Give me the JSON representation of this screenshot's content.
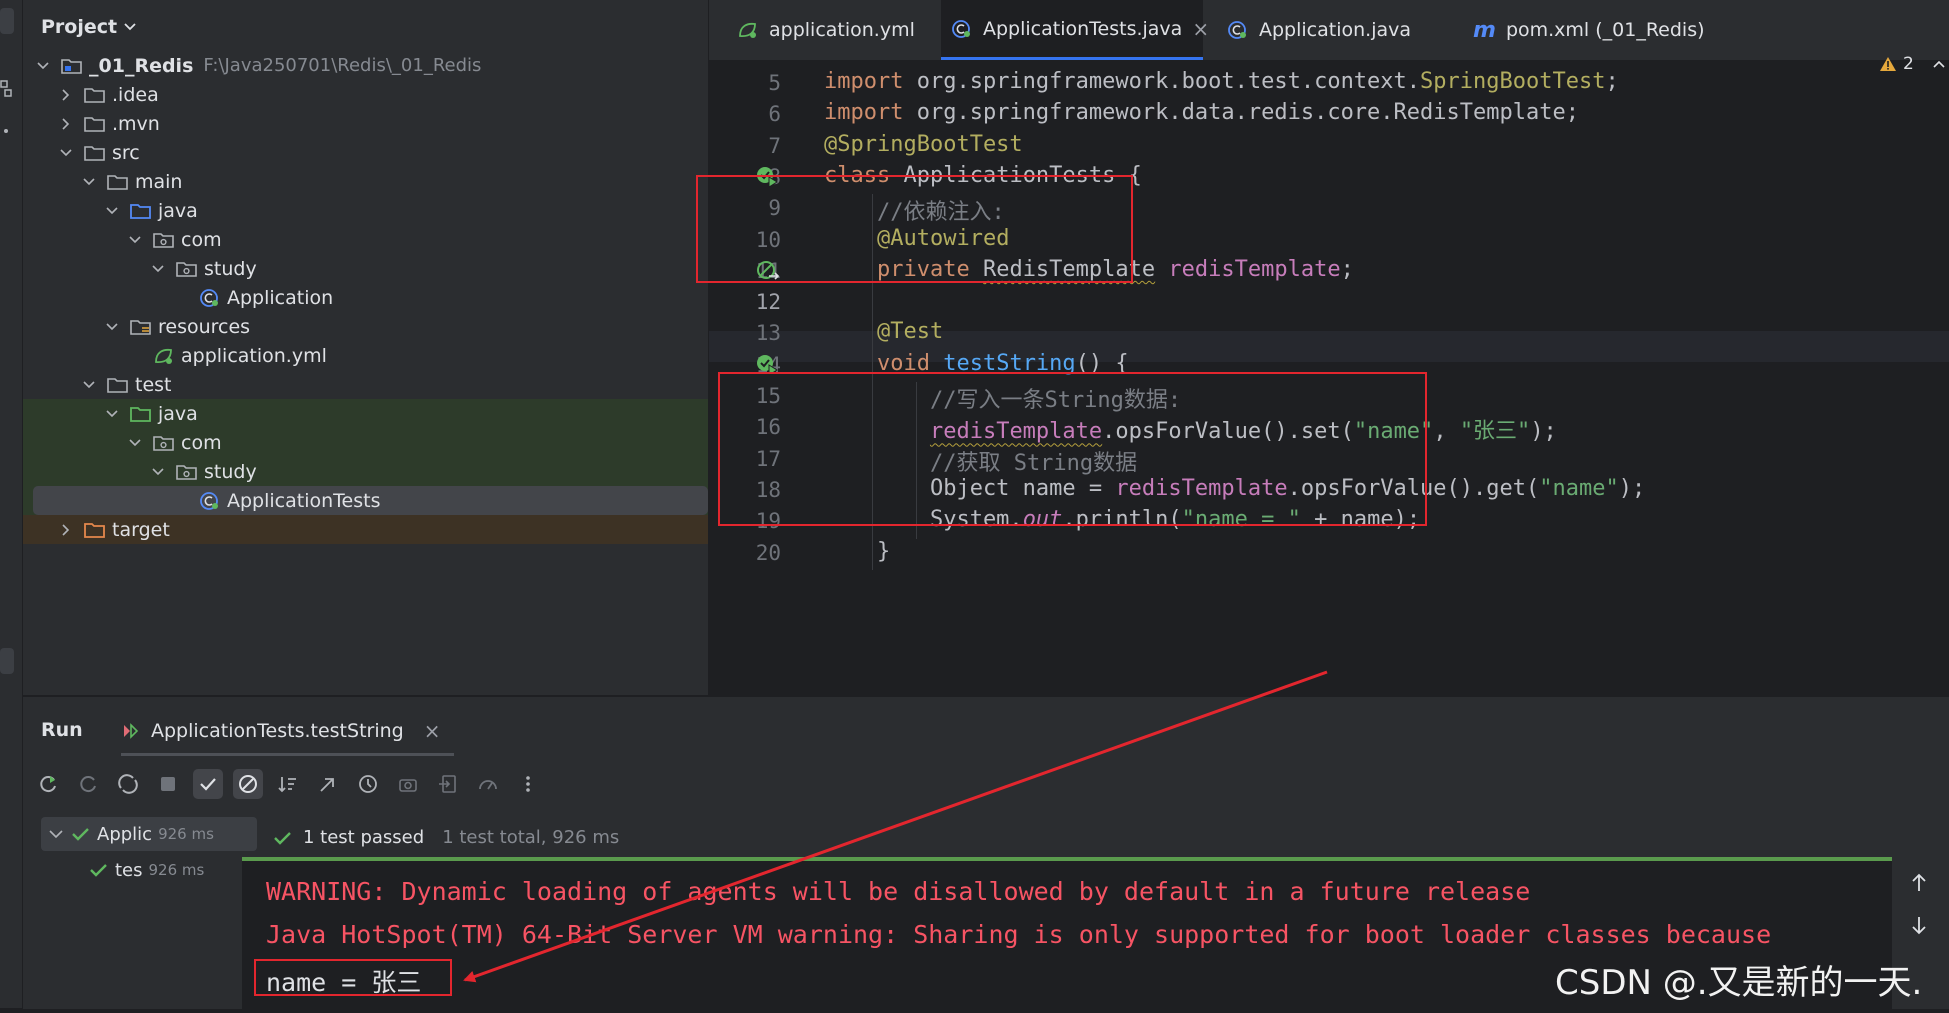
{
  "project": {
    "header": "Project",
    "tree": [
      {
        "label": "_01_Redis",
        "path": "F:\\Java250701\\Redis\\_01_Redis",
        "depth": 0,
        "expanded": true,
        "icon": "module-folder-icon",
        "bold": true
      },
      {
        "label": ".idea",
        "depth": 1,
        "expanded": false,
        "icon": "folder-icon"
      },
      {
        "label": ".mvn",
        "depth": 1,
        "expanded": false,
        "icon": "folder-icon"
      },
      {
        "label": "src",
        "depth": 1,
        "expanded": true,
        "icon": "folder-icon"
      },
      {
        "label": "main",
        "depth": 2,
        "expanded": true,
        "icon": "folder-icon"
      },
      {
        "label": "java",
        "depth": 3,
        "expanded": true,
        "icon": "source-folder-icon"
      },
      {
        "label": "com",
        "depth": 4,
        "expanded": true,
        "icon": "package-icon"
      },
      {
        "label": "study",
        "depth": 5,
        "expanded": true,
        "icon": "package-icon"
      },
      {
        "label": "Application",
        "depth": 6,
        "icon": "spring-class-icon"
      },
      {
        "label": "resources",
        "depth": 3,
        "expanded": true,
        "icon": "resources-folder-icon"
      },
      {
        "label": "application.yml",
        "depth": 4,
        "icon": "spring-yml-icon"
      },
      {
        "label": "test",
        "depth": 2,
        "expanded": true,
        "icon": "folder-icon"
      },
      {
        "label": "java",
        "depth": 3,
        "expanded": true,
        "icon": "test-folder-icon"
      },
      {
        "label": "com",
        "depth": 4,
        "expanded": true,
        "icon": "package-icon"
      },
      {
        "label": "study",
        "depth": 5,
        "expanded": true,
        "icon": "package-icon"
      },
      {
        "label": "ApplicationTests",
        "depth": 6,
        "icon": "spring-class-icon",
        "selected": true
      },
      {
        "label": "target",
        "depth": 1,
        "expanded": false,
        "icon": "excluded-folder-icon"
      }
    ]
  },
  "tabs": [
    {
      "label": "application.yml",
      "icon": "spring-yml-icon"
    },
    {
      "label": "ApplicationTests.java",
      "icon": "spring-class-icon",
      "active": true,
      "closable": "×"
    },
    {
      "label": "Application.java",
      "icon": "spring-class-icon"
    },
    {
      "label": "pom.xml (_01_Redis)",
      "icon": "maven-icon",
      "glyph": "m"
    }
  ],
  "inspection": {
    "count": "2",
    "icon": "warning-icon"
  },
  "editor": {
    "lines": [
      {
        "num": "5",
        "segments": [
          {
            "t": "import ",
            "c": "kw"
          },
          {
            "t": "org.springframework.boot.test.context.",
            "c": "cls"
          },
          {
            "t": "SpringBootTest",
            "c": "ann"
          },
          {
            "t": ";",
            "c": "cls"
          }
        ]
      },
      {
        "num": "6",
        "segments": [
          {
            "t": "import ",
            "c": "kw"
          },
          {
            "t": "org.springframework.data.redis.core.RedisTemplate;",
            "c": "cls"
          }
        ]
      },
      {
        "num": "7",
        "segments": [
          {
            "t": "@SpringBootTest",
            "c": "ann"
          }
        ]
      },
      {
        "num": "8",
        "gutter": "run-test-icon",
        "segments": [
          {
            "t": "class ",
            "c": "kw"
          },
          {
            "t": "ApplicationTests {",
            "c": "cls"
          }
        ]
      },
      {
        "num": "9",
        "segments": [
          {
            "t": "    //依赖注入:",
            "c": "cmt"
          }
        ]
      },
      {
        "num": "10",
        "segments": [
          {
            "t": "    ",
            "c": "cls"
          },
          {
            "t": "@Autowired",
            "c": "ann"
          }
        ]
      },
      {
        "num": "11",
        "gutter": "bean-navigate-icon",
        "segments": [
          {
            "t": "    ",
            "c": "cls"
          },
          {
            "t": "private ",
            "c": "kw"
          },
          {
            "t": "RedisTemplate",
            "c": "cls squiggle"
          },
          {
            "t": " ",
            "c": "cls"
          },
          {
            "t": "redisTemplate",
            "c": "fld"
          },
          {
            "t": ";",
            "c": "cls"
          }
        ]
      },
      {
        "num": "12",
        "segments": []
      },
      {
        "num": "13",
        "segments": [
          {
            "t": "    ",
            "c": "cls"
          },
          {
            "t": "@Test",
            "c": "ann"
          }
        ]
      },
      {
        "num": "14",
        "gutter": "run-test-icon",
        "segments": [
          {
            "t": "    ",
            "c": "cls"
          },
          {
            "t": "void ",
            "c": "kw"
          },
          {
            "t": "testString",
            "c": "fn"
          },
          {
            "t": "() {",
            "c": "cls"
          }
        ]
      },
      {
        "num": "15",
        "segments": [
          {
            "t": "        //写入一条String数据:",
            "c": "cmt"
          }
        ]
      },
      {
        "num": "16",
        "segments": [
          {
            "t": "        ",
            "c": "cls"
          },
          {
            "t": "redisTemplate",
            "c": "fld squiggle"
          },
          {
            "t": ".opsForValue().set(",
            "c": "cls"
          },
          {
            "t": "\"name\"",
            "c": "str"
          },
          {
            "t": ", ",
            "c": "cls"
          },
          {
            "t": "\"张三\"",
            "c": "str"
          },
          {
            "t": ");",
            "c": "cls"
          }
        ]
      },
      {
        "num": "17",
        "segments": [
          {
            "t": "        //获取 String数据",
            "c": "cmt"
          }
        ]
      },
      {
        "num": "18",
        "segments": [
          {
            "t": "        Object name = ",
            "c": "cls"
          },
          {
            "t": "redisTemplate",
            "c": "fld"
          },
          {
            "t": ".opsForValue().get(",
            "c": "cls"
          },
          {
            "t": "\"name\"",
            "c": "str"
          },
          {
            "t": ");",
            "c": "cls"
          }
        ]
      },
      {
        "num": "19",
        "segments": [
          {
            "t": "        System.",
            "c": "cls"
          },
          {
            "t": "out",
            "c": "ital"
          },
          {
            "t": ".println(",
            "c": "cls"
          },
          {
            "t": "\"name = \"",
            "c": "str"
          },
          {
            "t": " + name);",
            "c": "cls"
          }
        ]
      },
      {
        "num": "20",
        "segments": [
          {
            "t": "    }",
            "c": "cls"
          }
        ]
      }
    ]
  },
  "run": {
    "title": "Run",
    "tab_label": "ApplicationTests.testString",
    "tab_close": "×",
    "tree": [
      {
        "label": "Applic",
        "time": "926 ms"
      },
      {
        "label": "tes",
        "time": "926 ms"
      }
    ],
    "status": "1 test passed",
    "status_detail": "1 test total, 926 ms",
    "console": [
      "WARNING: Dynamic loading of agents will be disallowed by default in a future release",
      "Java HotSpot(TM) 64-Bit Server VM warning: Sharing is only supported for boot loader classes because",
      "name = 张三"
    ]
  },
  "watermark": "CSDN @.又是新的一天."
}
